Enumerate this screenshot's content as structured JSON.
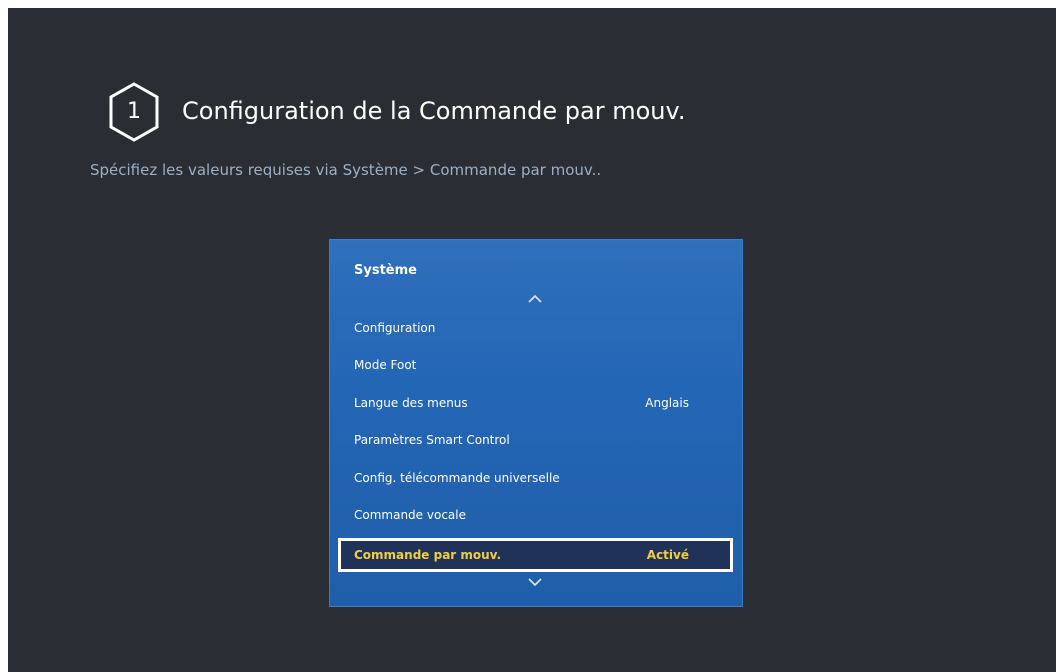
{
  "step": {
    "number": "1",
    "title": "Configuration de la Commande par mouv.",
    "instruction": "Spécifiez les valeurs requises via Système > Commande par mouv.."
  },
  "panel": {
    "title": "Système",
    "scroll_up_icon": "chevron-up-icon",
    "scroll_down_icon": "chevron-down-icon",
    "items": [
      {
        "label": "Configuration",
        "value": ""
      },
      {
        "label": "Mode Foot",
        "value": ""
      },
      {
        "label": "Langue des menus",
        "value": "Anglais"
      },
      {
        "label": "Paramètres Smart Control",
        "value": ""
      },
      {
        "label": "Config. télécommande universelle",
        "value": ""
      },
      {
        "label": "Commande vocale",
        "value": ""
      },
      {
        "label": "Commande par mouv.",
        "value": "Activé",
        "selected": true
      }
    ]
  },
  "colors": {
    "background": "#2a2d33",
    "panel": "#2466b6",
    "highlight_text": "#f2cf3a",
    "selection_bg": "#213259",
    "subtitle": "#9db0c2"
  }
}
